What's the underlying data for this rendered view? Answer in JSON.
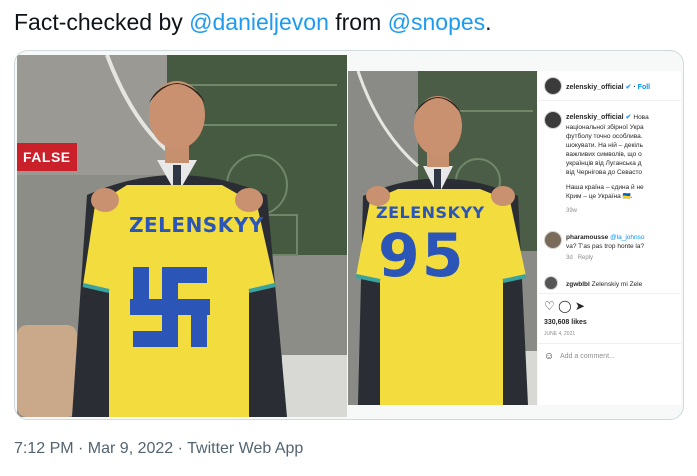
{
  "tweet": {
    "text_prefix": "Fact-checked by ",
    "mention1": "@danieljevon",
    "text_middle": " from ",
    "mention2": "@snopes",
    "text_suffix": ".",
    "timestamp": "7:12 PM · Mar 9, 2022 · Twitter Web App"
  },
  "left_image": {
    "badge": "FALSE",
    "shirt_name": "ZELENSKYY"
  },
  "mid_image": {
    "shirt_name": "ZELENSKYY",
    "shirt_number": "95"
  },
  "instagram": {
    "header_user": "zelenskiy_official",
    "header_follow": "Foll",
    "caption_user": "zelenskiy_official",
    "caption_lines": [
      "Нова",
      "національної збірної Укра",
      "футболу точно особлива.",
      "шокувати. На ній – декіль",
      "важливих символів, що о",
      "українців від Луганська д",
      "від Чернігова до Севасто",
      "Наша країна – єдина й не",
      "Крим – це Україна 🇺🇦."
    ],
    "caption_time": "39w",
    "comment1_user": "pharamousse",
    "comment1_mention": "@la_johnso",
    "comment1_line2": "va? T'as pas trop honte la?",
    "comment1_meta_time": "3d",
    "comment1_meta_reply": "Reply",
    "comment2_user": "zgwblbl",
    "comment2_text": "Zelenskiy mi Zele",
    "likes": "330,608 likes",
    "date": "JUNE 4, 2021",
    "add_comment": "Add a comment..."
  },
  "colors": {
    "mention": "#1d9bf0",
    "false_badge": "#c9202a",
    "shirt_yellow": "#f2dc3e",
    "shirt_blue": "#2b56b8",
    "timestamp": "#536471"
  }
}
